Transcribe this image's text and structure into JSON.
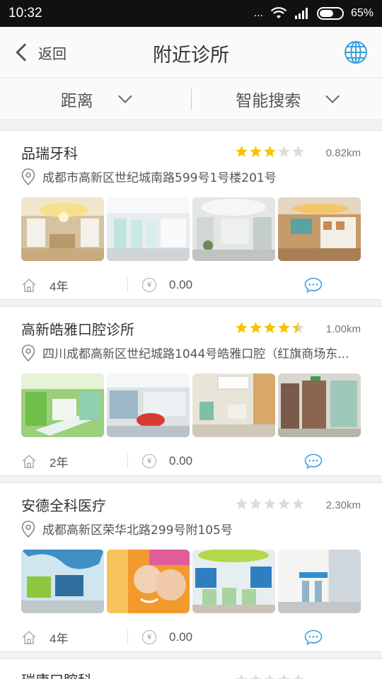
{
  "status": {
    "time": "10:32",
    "dots": "...",
    "battery": "65%",
    "battery_level": 0.65
  },
  "nav": {
    "back_label": "返回",
    "title": "附近诊所"
  },
  "filters": [
    {
      "label": "距离"
    },
    {
      "label": "智能搜索"
    }
  ],
  "clinics": [
    {
      "name": "品瑞牙科",
      "rating": 3,
      "distance": "0.82km",
      "address": "成都市高新区世纪城南路599号1号楼201号",
      "years": "4年",
      "price": "0.00"
    },
    {
      "name": "高新皓雅口腔诊所",
      "rating": 4.5,
      "distance": "1.00km",
      "address": "四川成都高新区世纪城路1044号皓雅口腔（红旗商场东...",
      "years": "2年",
      "price": "0.00"
    },
    {
      "name": "安德全科医疗",
      "rating": 0,
      "distance": "2.30km",
      "address": "成都高新区荣华北路299号附105号",
      "years": "4年",
      "price": "0.00"
    },
    {
      "name": "瑞康口腔科",
      "rating": 0,
      "distance": ""
    }
  ],
  "colors": {
    "star_on": "#f5c400",
    "star_off": "#dcdcdc",
    "accent": "#3aa0e0"
  }
}
